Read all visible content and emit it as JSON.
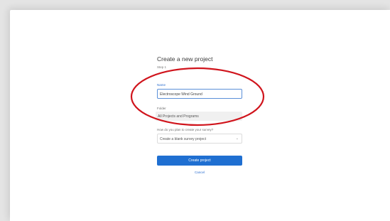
{
  "dialog": {
    "title": "Create a new project",
    "subtitle": "Step 1",
    "name_label": "Name",
    "name_value": "Electroscope Wind Ground",
    "folder_label": "Folder",
    "folder_value": "All Projects and Programs",
    "how_label": "How do you plan to create your survey?",
    "how_value": "Create a blank survey project",
    "create_button": "Create project",
    "cancel_link": "Cancel"
  },
  "annotation": {
    "color": "#d0141c"
  }
}
